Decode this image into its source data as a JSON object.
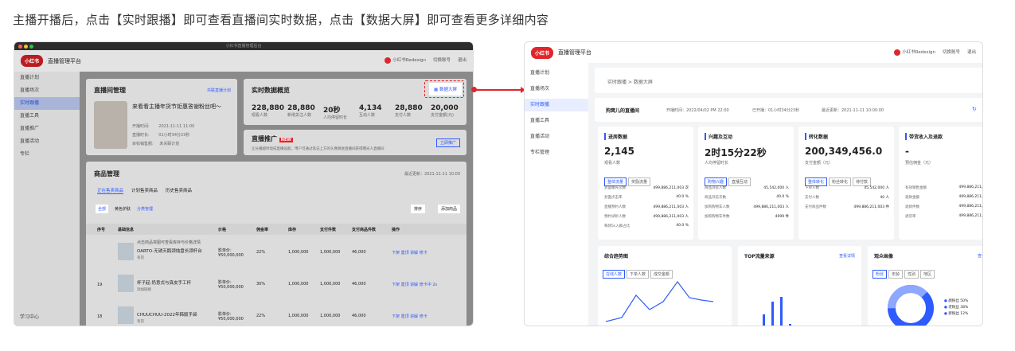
{
  "caption": "主播开播后，点击【实时跟播】即可查看直播间实时数据，点击【数据大屏】即可查看更多详细内容",
  "win1": {
    "title": "小红书直播管理后台",
    "brand": "小红书",
    "platform": "直播管理平台",
    "user": "小红书Redesign",
    "switch": "切换账号",
    "logout": "退出",
    "sidebar": [
      "直播计划",
      "直播场次",
      "实时跟播",
      "直播工具",
      "直播推广",
      "直播活动",
      "专栏"
    ],
    "sidebar_bottom": "学习中心",
    "room": {
      "title": "直播间管理",
      "btn": "共联直播计划",
      "name": "来看看主播年货节钜惠答谢粉丝吧～",
      "start_l": "开播时间:",
      "start": "2021-11-11 11:00",
      "dur_l": "直播时长:",
      "dur": "01小时34分23秒",
      "target_l": "目标销售额:",
      "target": "未关联计划"
    },
    "realtime": {
      "title": "实时数据概览",
      "btn": "数据大屏",
      "stats": [
        {
          "v": "228,880",
          "l": "观看人数"
        },
        {
          "v": "28,880",
          "l": "新增关注人数"
        },
        {
          "v": "20秒",
          "l": "人均停留时长"
        },
        {
          "v": "4,134",
          "l": "互动人数"
        },
        {
          "v": "28,880",
          "l": "支付人数"
        },
        {
          "v": "20,000",
          "l": "支付金额(元)"
        }
      ]
    },
    "promo": {
      "title": "直播推广",
      "badge": "NEW",
      "desc": "让长播越时现成直播设能，用户可通过笔记上方的头像跳进直播间获得曝光人直播间",
      "btn": "立即推广"
    },
    "goods": {
      "title": "商品管理",
      "update": "最近更新：2021-11-11 10:00",
      "tabs": [
        "正在售卖商品",
        "计划售卖商品",
        "历史售卖商品"
      ],
      "filters": [
        "全部",
        "黄色护肤",
        "分类管理"
      ],
      "sort": "排序",
      "add": "添加商品",
      "cols": [
        "序号",
        "基础信息",
        "价格",
        "佣金率",
        "库存",
        "支付件数",
        "支付商品件数",
        "操作"
      ],
      "rows": [
        {
          "no": "",
          "n1": "点击商品将图可查看库存与价格详情",
          "n2": "OARTO-无锈天鹅颈烛盘长颈杆台",
          "n3": "有货",
          "price": "影单价:¥50,000,000",
          "rate": "22%",
          "stock": "1,000,000",
          "pay": "1,000,000",
          "cnt": "46,000",
          "ops": "下架 置顶 讲解 修卡"
        },
        {
          "no": "19",
          "n1": "",
          "n2": "杯子起-奶意式与真皮手工杯",
          "n3": "添加链接",
          "price": "影单价:¥50,000,000",
          "rate": "30%",
          "stock": "1,000,000",
          "pay": "1,000,000",
          "cnt": "46,000",
          "ops": "下架 置顶 讲解 修卡中 2s"
        },
        {
          "no": "18",
          "n1": "",
          "n2": "CHUUCHUU-2022年韩版手袋",
          "n3": "有货",
          "price": "影单价:¥50,000,000",
          "rate": "22%",
          "stock": "1,000,000",
          "pay": "1,000,000",
          "cnt": "46,000",
          "ops": "下架 置顶 讲解 修卡"
        }
      ]
    }
  },
  "win2": {
    "brand": "小红书",
    "platform": "直播管理平台",
    "user": "小红书Redesign",
    "switch": "切换账号",
    "logout": "退出",
    "sidebar": [
      "直播计划",
      "直播场次",
      "实时跟播",
      "直播工具",
      "直播活动",
      "专栏管理"
    ],
    "crumb": "实时跟播  >  数据大屏",
    "live": {
      "name": "狗窝儿的直播间",
      "start": "开播时间：2022/04/02 PM 22:00",
      "dur": "已开播：01小时34分23秒",
      "update": "最近更新：2021-11-11 10:00:00"
    },
    "panels": [
      {
        "title": "进房数据",
        "big": "2,145",
        "sub": "观看人数",
        "tags": [
          "整体流量",
          "奖励流量"
        ],
        "rows": [
          [
            "封面曝光次数",
            "499,886,211,003 次"
          ],
          [
            "封面点击率",
            "40.0 %"
          ],
          [
            "直播预约人数",
            "499,886,211,003 人"
          ],
          [
            "预约试听人数",
            "499,886,211,003 人"
          ],
          [
            "每场5s入群占比",
            "40.0 %"
          ]
        ]
      },
      {
        "title": "兴趣及互动",
        "big": "2时15分22秒",
        "sub": "人均停留时长",
        "tags": [
          "购物兴趣",
          "直播互动"
        ],
        "rows": [
          [
            "商品浏览人数",
            "45,542,000 人"
          ],
          [
            "商品浏览次数",
            "40.0 %"
          ],
          [
            "加购购物车人数",
            "499,886,211,003 人"
          ],
          [
            "加购购物车件数",
            "4099 件"
          ]
        ]
      },
      {
        "title": "转化数据",
        "big": "200,349,456.0",
        "sub": "支付金额（元）",
        "tags": [
          "整体转化",
          "粉丝转化",
          "待付款"
        ],
        "rows": [
          [
            "下单人数",
            "45,542,000 人"
          ],
          [
            "支付人数",
            "40 人"
          ],
          [
            "支付商品件数",
            "499,886,211,003 件"
          ]
        ]
      },
      {
        "title": "带货收入及退款",
        "big": "-",
        "sub": "预估佣金（元）",
        "tags": [],
        "rows": [
          [
            "有效销售金额",
            "499,886,211,003"
          ],
          [
            "退款金额",
            "499,886,211,003"
          ],
          [
            "退款件数",
            "499,886,211,003"
          ],
          [
            "退货率",
            "499,886,211,003"
          ]
        ]
      }
    ],
    "trend": {
      "title": "综合趋势图",
      "tabs": [
        "在线人数",
        "下单人数",
        "成交金额"
      ]
    },
    "top": {
      "title": "TOP流量来源",
      "link": "查看详情"
    },
    "portrait": {
      "title": "观众画像",
      "link": "查看",
      "tabs": [
        "粉丝",
        "年龄",
        "性别",
        "地区"
      ],
      "legend": [
        "颜粉丝 50%",
        "老粉丝 38%",
        "新粉丝 12%"
      ]
    }
  }
}
